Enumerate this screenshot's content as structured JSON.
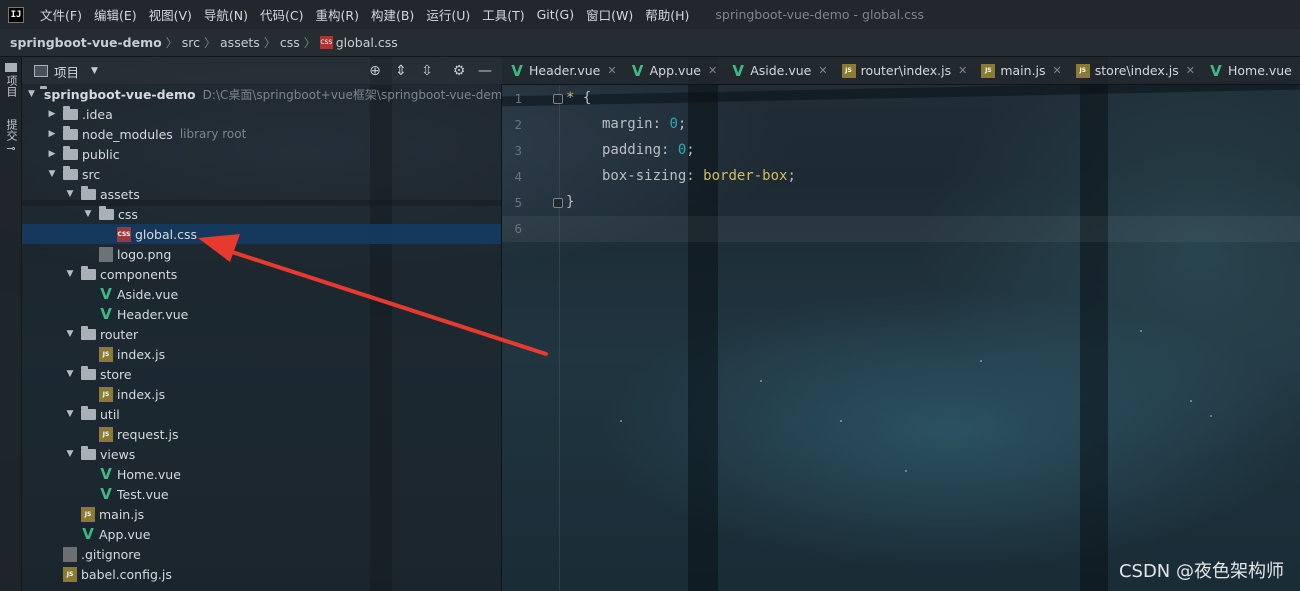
{
  "menubar": {
    "logo_text": "IJ",
    "items": [
      "文件(F)",
      "编辑(E)",
      "视图(V)",
      "导航(N)",
      "代码(C)",
      "重构(R)",
      "构建(B)",
      "运行(U)",
      "工具(T)",
      "Git(G)",
      "窗口(W)",
      "帮助(H)"
    ],
    "window_title": "springboot-vue-demo - global.css"
  },
  "breadcrumb": {
    "project": "springboot-vue-demo",
    "parts": [
      "src",
      "assets",
      "css"
    ],
    "file": "global.css",
    "file_badge": "CSS"
  },
  "toolstrip": {
    "project_tab": "项目",
    "commit_tab": "提交"
  },
  "project_panel": {
    "title": "项目",
    "tool_icons": [
      "crosshair-icon",
      "expand-all-icon",
      "collapse-all-icon",
      "gear-icon",
      "minimize-icon"
    ],
    "tree": [
      {
        "label": "springboot-vue-demo",
        "extra": "D:\\C桌面\\springboot+vue框架\\springboot-vue-demo",
        "type": "module",
        "expanded": true,
        "bold": true
      },
      {
        "label": ".idea",
        "type": "folder",
        "expanded": false
      },
      {
        "label": "node_modules",
        "extra": "library root",
        "type": "folder",
        "expanded": false
      },
      {
        "label": "public",
        "type": "folder",
        "expanded": false
      },
      {
        "label": "src",
        "type": "folder",
        "expanded": true
      },
      {
        "label": "assets",
        "type": "folder",
        "expanded": true
      },
      {
        "label": "css",
        "type": "folder",
        "expanded": true
      },
      {
        "label": "global.css",
        "type": "css",
        "selected": true
      },
      {
        "label": "logo.png",
        "type": "png"
      },
      {
        "label": "components",
        "type": "folder",
        "expanded": true
      },
      {
        "label": "Aside.vue",
        "type": "vue"
      },
      {
        "label": "Header.vue",
        "type": "vue"
      },
      {
        "label": "router",
        "type": "folder",
        "expanded": true
      },
      {
        "label": "index.js",
        "type": "js"
      },
      {
        "label": "store",
        "type": "folder",
        "expanded": true
      },
      {
        "label": "index.js",
        "type": "js"
      },
      {
        "label": "util",
        "type": "folder",
        "expanded": true
      },
      {
        "label": "request.js",
        "type": "js"
      },
      {
        "label": "views",
        "type": "folder",
        "expanded": true
      },
      {
        "label": "Home.vue",
        "type": "vue"
      },
      {
        "label": "Test.vue",
        "type": "vue"
      },
      {
        "label": "main.js",
        "type": "js"
      },
      {
        "label": "App.vue",
        "type": "vue"
      },
      {
        "label": ".gitignore",
        "type": "git"
      },
      {
        "label": "babel.config.js",
        "type": "js"
      }
    ]
  },
  "tabs": [
    {
      "label": "Header.vue",
      "type": "vue"
    },
    {
      "label": "App.vue",
      "type": "vue"
    },
    {
      "label": "Aside.vue",
      "type": "vue"
    },
    {
      "label": "router\\index.js",
      "type": "js"
    },
    {
      "label": "main.js",
      "type": "js"
    },
    {
      "label": "store\\index.js",
      "type": "js"
    },
    {
      "label": "Home.vue",
      "type": "vue"
    }
  ],
  "editor": {
    "line_numbers": [
      "1",
      "2",
      "3",
      "4",
      "5",
      "6"
    ],
    "code": {
      "l1_selector": "*",
      "l1_brace": " {",
      "l2_prop": "margin: ",
      "l2_val": "0",
      "l2_end": ";",
      "l3_prop": "padding: ",
      "l3_val": "0",
      "l3_end": ";",
      "l4_prop": "box-sizing: ",
      "l4_val": "border-box",
      "l4_end": ";",
      "l5_brace": "}"
    }
  },
  "watermark": "CSDN @夜色架构师",
  "colors": {
    "annotation_arrow": "#e8392f",
    "vue_green": "#41b883",
    "selection": "#143c64"
  }
}
